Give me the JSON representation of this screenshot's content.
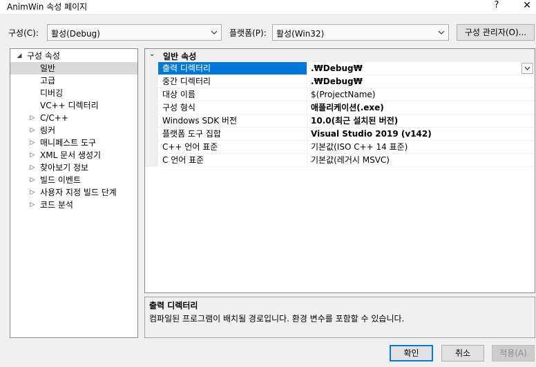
{
  "window": {
    "title": "AnimWin 속성 페이지",
    "help": "?",
    "close": "✕"
  },
  "toolbar": {
    "config_label": "구성(C):",
    "config_value": "활성(Debug)",
    "platform_label": "플랫폼(P):",
    "platform_value": "활성(Win32)",
    "manager_label": "구성 관리자(O)..."
  },
  "tree": {
    "items": [
      {
        "label": "구성 속성",
        "expander": "◢"
      },
      {
        "label": "일반",
        "expander": ""
      },
      {
        "label": "고급",
        "expander": ""
      },
      {
        "label": "디버깅",
        "expander": ""
      },
      {
        "label": "VC++ 디렉터리",
        "expander": ""
      },
      {
        "label": "C/C++",
        "expander": "▷"
      },
      {
        "label": "링커",
        "expander": "▷"
      },
      {
        "label": "매니페스트 도구",
        "expander": "▷"
      },
      {
        "label": "XML 문서 생성기",
        "expander": "▷"
      },
      {
        "label": "찾아보기 정보",
        "expander": "▷"
      },
      {
        "label": "빌드 이벤트",
        "expander": "▷"
      },
      {
        "label": "사용자 지정 빌드 단계",
        "expander": "▷"
      },
      {
        "label": "코드 분석",
        "expander": "▷"
      }
    ]
  },
  "grid": {
    "category": "일반 속성",
    "category_expander": "⌄",
    "rows": [
      {
        "name": "출력 디렉터리",
        "value": ".₩Debug₩"
      },
      {
        "name": "중간 디렉터리",
        "value": ".₩Debug₩"
      },
      {
        "name": "대상 이름",
        "value": "$(ProjectName)"
      },
      {
        "name": "구성 형식",
        "value": "애플리케이션(.exe)"
      },
      {
        "name": "Windows SDK 버전",
        "value": "10.0(최근 설치된 버전)"
      },
      {
        "name": "플랫폼 도구 집합",
        "value": "Visual Studio 2019 (v142)"
      },
      {
        "name": "C++ 언어 표준",
        "value": "기본값(ISO C++ 14 표준)"
      },
      {
        "name": "C 언어 표준",
        "value": "기본값(레거시 MSVC)"
      }
    ]
  },
  "description": {
    "title": "출력 디렉터리",
    "text": "컴파일된 프로그램이 배치될 경로입니다. 환경 변수를 포함할 수 있습니다."
  },
  "buttons": {
    "ok": "확인",
    "cancel": "취소",
    "apply": "적용(A)"
  },
  "colors": {
    "selection": "#0078d7",
    "tree_selection": "#d9d9d9"
  }
}
